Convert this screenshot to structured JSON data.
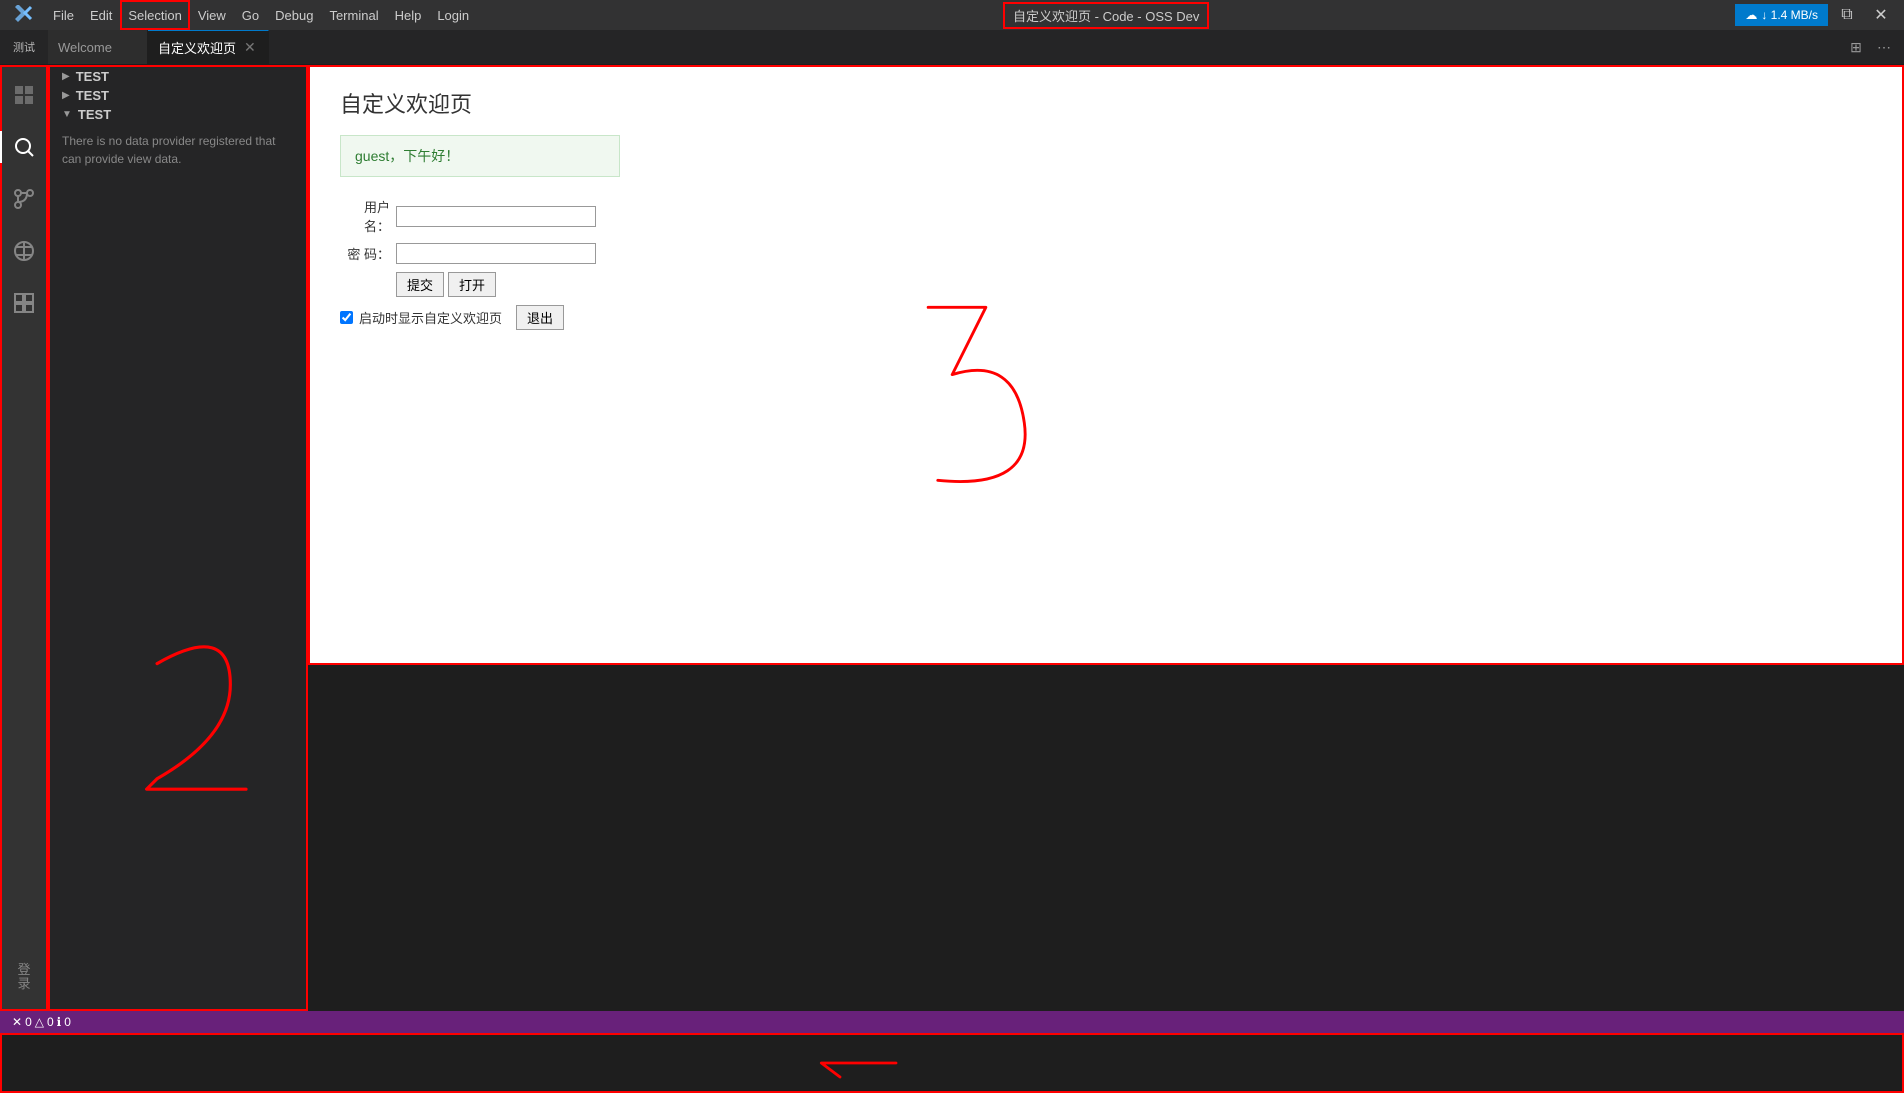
{
  "titlebar": {
    "logo": "≡",
    "menu": [
      "File",
      "Edit",
      "Selection",
      "View",
      "Go",
      "Debug",
      "Terminal",
      "Help",
      "Login"
    ],
    "selection_highlighted": "Selection",
    "center_title": "自定义欢迎页 - Code - OSS Dev",
    "network_btn": "↓ 1.4 MB/s",
    "win_btns": [
      "⧉",
      "✕"
    ]
  },
  "tabbar": {
    "sidebar_title": "测试",
    "tabs": [
      {
        "label": "Welcome",
        "active": false,
        "closable": false
      },
      {
        "label": "自定义欢迎页",
        "active": true,
        "closable": true
      }
    ]
  },
  "sidebar": {
    "items": [
      {
        "label": "TEST",
        "expanded": false,
        "arrow": "▶"
      },
      {
        "label": "TEST",
        "expanded": false,
        "arrow": "▶"
      },
      {
        "label": "TEST",
        "expanded": true,
        "arrow": "▼"
      }
    ],
    "no_data_msg": "There is no data provider registered that can provide view data."
  },
  "activity_icons": [
    {
      "name": "explorer-icon",
      "symbol": "⎘",
      "active": false
    },
    {
      "name": "search-icon",
      "symbol": "🔍",
      "active": true
    },
    {
      "name": "source-control-icon",
      "symbol": "⑂",
      "active": false
    },
    {
      "name": "debug-icon",
      "symbol": "⊘",
      "active": false
    },
    {
      "name": "extensions-icon",
      "symbol": "⊞",
      "active": false
    }
  ],
  "activity_bottom": [
    {
      "name": "account-icon",
      "line1": "登",
      "line2": "录"
    }
  ],
  "welcome_page": {
    "title": "自定义欢迎页",
    "greeting": "guest，下午好！",
    "username_label": "用户名：",
    "password_label": "密 码：",
    "submit_btn": "提交",
    "open_btn": "打开",
    "checkbox_label": "启动时显示自定义欢迎页",
    "logout_btn": "退出"
  },
  "statusbar": {
    "errors": "0",
    "warnings": "0",
    "info": "0",
    "error_icon": "✕",
    "warning_icon": "△",
    "info_icon": "ℹ"
  }
}
